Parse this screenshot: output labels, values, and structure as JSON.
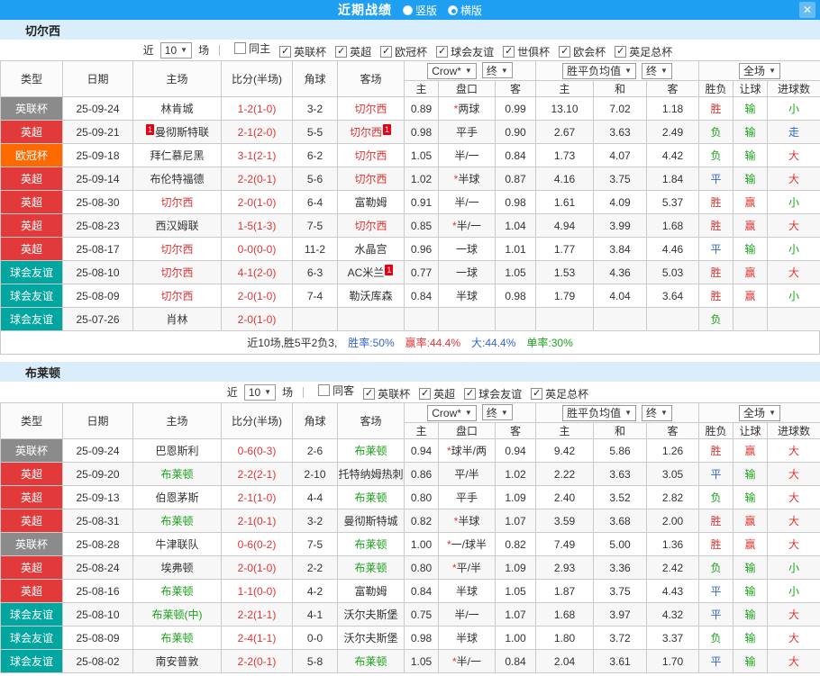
{
  "titlebar": {
    "title": "近期战绩",
    "radios": [
      {
        "label": "竖版",
        "selected": false
      },
      {
        "label": "横版",
        "selected": true
      }
    ],
    "close_label": "✕"
  },
  "filter_labels": {
    "near": "近",
    "count": "10",
    "games": "场"
  },
  "header": {
    "type": "类型",
    "date": "日期",
    "home": "主场",
    "score": "比分(半场)",
    "corner": "角球",
    "away": "客场",
    "odds_company": "Crow*",
    "final1": "终",
    "avg_label": "胜平负均值",
    "final2": "终",
    "scope": "全场",
    "sub": [
      "主",
      "盘口",
      "客",
      "主",
      "和",
      "客",
      "胜负",
      "让球",
      "进球数"
    ]
  },
  "ui_colors": {
    "titlebar_bg": "#1E9FF2",
    "section_band_bg": "#D9EDFB",
    "score_red": "#E23434",
    "win_red": "#E23434",
    "draw_blue": "#3566CD",
    "lose_green": "#1CA21C"
  },
  "type_colors": {
    "英联杯": "#8B8B8B",
    "英超": "#E23A3A",
    "欧冠杯": "#FF6A00",
    "球会友谊": "#01A6A0"
  },
  "result_colors": {
    "胜": "#E23434",
    "赢": "#E23434",
    "大": "#E23434",
    "平": "#3566CD",
    "走": "#3566CD",
    "负": "#1CA21C",
    "输": "#1CA21C",
    "小": "#1CA21C"
  },
  "sections": [
    {
      "team": "切尔西",
      "focus_color": "#E23434",
      "same_label": "同主",
      "same_checked": false,
      "leagues": [
        "英联杯",
        "英超",
        "欧冠杯",
        "球会友谊",
        "世俱杯",
        "欧会杯",
        "英足总杯"
      ],
      "rows": [
        {
          "type": "英联杯",
          "date": "25-09-24",
          "home": {
            "name": "林肯城"
          },
          "score": "1-2(1-0)",
          "corner": "3-2",
          "away": {
            "name": "切尔西",
            "focus": true
          },
          "odds": [
            "0.89",
            "*两球",
            "0.99"
          ],
          "avg": [
            "13.10",
            "7.02",
            "1.18"
          ],
          "result": "胜",
          "handicap_result": "输",
          "goals": "小"
        },
        {
          "type": "英超",
          "date": "25-09-21",
          "home": {
            "name": "曼彻斯特联",
            "badge": "1",
            "badge_pos": "before"
          },
          "score": "2-1(2-0)",
          "corner": "5-5",
          "away": {
            "name": "切尔西",
            "focus": true,
            "badge": "1",
            "badge_pos": "after"
          },
          "odds": [
            "0.98",
            "平手",
            "0.90"
          ],
          "avg": [
            "2.67",
            "3.63",
            "2.49"
          ],
          "result": "负",
          "handicap_result": "输",
          "goals": "走"
        },
        {
          "type": "欧冠杯",
          "date": "25-09-18",
          "home": {
            "name": "拜仁慕尼黑"
          },
          "score": "3-1(2-1)",
          "corner": "6-2",
          "away": {
            "name": "切尔西",
            "focus": true
          },
          "odds": [
            "1.05",
            "半/一",
            "0.84"
          ],
          "avg": [
            "1.73",
            "4.07",
            "4.42"
          ],
          "result": "负",
          "handicap_result": "输",
          "goals": "大"
        },
        {
          "type": "英超",
          "date": "25-09-14",
          "home": {
            "name": "布伦特福德"
          },
          "score": "2-2(0-1)",
          "corner": "5-6",
          "away": {
            "name": "切尔西",
            "focus": true
          },
          "odds": [
            "1.02",
            "*半球",
            "0.87"
          ],
          "avg": [
            "4.16",
            "3.75",
            "1.84"
          ],
          "result": "平",
          "handicap_result": "输",
          "goals": "大"
        },
        {
          "type": "英超",
          "date": "25-08-30",
          "home": {
            "name": "切尔西",
            "focus": true
          },
          "score": "2-0(1-0)",
          "corner": "6-4",
          "away": {
            "name": "富勒姆"
          },
          "odds": [
            "0.91",
            "半/一",
            "0.98"
          ],
          "avg": [
            "1.61",
            "4.09",
            "5.37"
          ],
          "result": "胜",
          "handicap_result": "赢",
          "goals": "小"
        },
        {
          "type": "英超",
          "date": "25-08-23",
          "home": {
            "name": "西汉姆联"
          },
          "score": "1-5(1-3)",
          "corner": "7-5",
          "away": {
            "name": "切尔西",
            "focus": true
          },
          "odds": [
            "0.85",
            "*半/一",
            "1.04"
          ],
          "avg": [
            "4.94",
            "3.99",
            "1.68"
          ],
          "result": "胜",
          "handicap_result": "赢",
          "goals": "大"
        },
        {
          "type": "英超",
          "date": "25-08-17",
          "home": {
            "name": "切尔西",
            "focus": true
          },
          "score": "0-0(0-0)",
          "corner": "11-2",
          "away": {
            "name": "水晶宫"
          },
          "odds": [
            "0.96",
            "一球",
            "1.01"
          ],
          "avg": [
            "1.77",
            "3.84",
            "4.46"
          ],
          "result": "平",
          "handicap_result": "输",
          "goals": "小"
        },
        {
          "type": "球会友谊",
          "date": "25-08-10",
          "home": {
            "name": "切尔西",
            "focus": true
          },
          "score": "4-1(2-0)",
          "corner": "6-3",
          "away": {
            "name": "AC米兰",
            "badge": "1",
            "badge_pos": "after"
          },
          "odds": [
            "0.77",
            "一球",
            "1.05"
          ],
          "avg": [
            "1.53",
            "4.36",
            "5.03"
          ],
          "result": "胜",
          "handicap_result": "赢",
          "goals": "大"
        },
        {
          "type": "球会友谊",
          "date": "25-08-09",
          "home": {
            "name": "切尔西",
            "focus": true
          },
          "score": "2-0(1-0)",
          "corner": "7-4",
          "away": {
            "name": "勒沃库森"
          },
          "odds": [
            "0.84",
            "半球",
            "0.98"
          ],
          "avg": [
            "1.79",
            "4.04",
            "3.64"
          ],
          "result": "胜",
          "handicap_result": "赢",
          "goals": "小"
        },
        {
          "type": "球会友谊",
          "date": "25-07-26",
          "home": {
            "name": "肖林"
          },
          "score": "2-0(1-0)",
          "corner": "",
          "away": {
            "name": ""
          },
          "odds": [
            "",
            "",
            ""
          ],
          "avg": [
            "",
            "",
            ""
          ],
          "result": "负",
          "handicap_result": "",
          "goals": ""
        }
      ],
      "summary": [
        {
          "text": "近10场,胜5平2负3,",
          "color": "#333333"
        },
        {
          "text": "胜率:50%",
          "color": "#3566CD"
        },
        {
          "text": "赢率:44.4%",
          "color": "#E23434"
        },
        {
          "text": "大:44.4%",
          "color": "#3566CD"
        },
        {
          "text": "单率:30%",
          "color": "#1CA21C"
        }
      ]
    },
    {
      "team": "布莱顿",
      "focus_color": "#1CA21C",
      "same_label": "同客",
      "same_checked": false,
      "leagues": [
        "英联杯",
        "英超",
        "球会友谊",
        "英足总杯"
      ],
      "rows": [
        {
          "type": "英联杯",
          "date": "25-09-24",
          "home": {
            "name": "巴恩斯利"
          },
          "score": "0-6(0-3)",
          "corner": "2-6",
          "away": {
            "name": "布莱顿",
            "focus": true
          },
          "odds": [
            "0.94",
            "*球半/两",
            "0.94"
          ],
          "avg": [
            "9.42",
            "5.86",
            "1.26"
          ],
          "result": "胜",
          "handicap_result": "赢",
          "goals": "大"
        },
        {
          "type": "英超",
          "date": "25-09-20",
          "home": {
            "name": "布莱顿",
            "focus": true
          },
          "score": "2-2(2-1)",
          "corner": "2-10",
          "away": {
            "name": "托特纳姆热刺"
          },
          "odds": [
            "0.86",
            "平/半",
            "1.02"
          ],
          "avg": [
            "2.22",
            "3.63",
            "3.05"
          ],
          "result": "平",
          "handicap_result": "输",
          "goals": "大"
        },
        {
          "type": "英超",
          "date": "25-09-13",
          "home": {
            "name": "伯恩茅斯"
          },
          "score": "2-1(1-0)",
          "corner": "4-4",
          "away": {
            "name": "布莱顿",
            "focus": true
          },
          "odds": [
            "0.80",
            "平手",
            "1.09"
          ],
          "avg": [
            "2.40",
            "3.52",
            "2.82"
          ],
          "result": "负",
          "handicap_result": "输",
          "goals": "大"
        },
        {
          "type": "英超",
          "date": "25-08-31",
          "home": {
            "name": "布莱顿",
            "focus": true
          },
          "score": "2-1(0-1)",
          "corner": "3-2",
          "away": {
            "name": "曼彻斯特城"
          },
          "odds": [
            "0.82",
            "*半球",
            "1.07"
          ],
          "avg": [
            "3.59",
            "3.68",
            "2.00"
          ],
          "result": "胜",
          "handicap_result": "赢",
          "goals": "大"
        },
        {
          "type": "英联杯",
          "date": "25-08-28",
          "home": {
            "name": "牛津联队"
          },
          "score": "0-6(0-2)",
          "corner": "7-5",
          "away": {
            "name": "布莱顿",
            "focus": true
          },
          "odds": [
            "1.00",
            "*一/球半",
            "0.82"
          ],
          "avg": [
            "7.49",
            "5.00",
            "1.36"
          ],
          "result": "胜",
          "handicap_result": "赢",
          "goals": "大"
        },
        {
          "type": "英超",
          "date": "25-08-24",
          "home": {
            "name": "埃弗顿"
          },
          "score": "2-0(1-0)",
          "corner": "2-2",
          "away": {
            "name": "布莱顿",
            "focus": true
          },
          "odds": [
            "0.80",
            "*平/半",
            "1.09"
          ],
          "avg": [
            "2.93",
            "3.36",
            "2.42"
          ],
          "result": "负",
          "handicap_result": "输",
          "goals": "小"
        },
        {
          "type": "英超",
          "date": "25-08-16",
          "home": {
            "name": "布莱顿",
            "focus": true
          },
          "score": "1-1(0-0)",
          "corner": "4-2",
          "away": {
            "name": "富勒姆"
          },
          "odds": [
            "0.84",
            "半球",
            "1.05"
          ],
          "avg": [
            "1.87",
            "3.75",
            "4.43"
          ],
          "result": "平",
          "handicap_result": "输",
          "goals": "小"
        },
        {
          "type": "球会友谊",
          "date": "25-08-10",
          "home": {
            "name": "布莱顿(中)",
            "focus": true
          },
          "score": "2-2(1-1)",
          "corner": "4-1",
          "away": {
            "name": "沃尔夫斯堡"
          },
          "odds": [
            "0.75",
            "半/一",
            "1.07"
          ],
          "avg": [
            "1.68",
            "3.97",
            "4.32"
          ],
          "result": "平",
          "handicap_result": "输",
          "goals": "大"
        },
        {
          "type": "球会友谊",
          "date": "25-08-09",
          "home": {
            "name": "布莱顿",
            "focus": true
          },
          "score": "2-4(1-1)",
          "corner": "0-0",
          "away": {
            "name": "沃尔夫斯堡"
          },
          "odds": [
            "0.98",
            "半球",
            "1.00"
          ],
          "avg": [
            "1.80",
            "3.72",
            "3.37"
          ],
          "result": "负",
          "handicap_result": "输",
          "goals": "大"
        },
        {
          "type": "球会友谊",
          "date": "25-08-02",
          "home": {
            "name": "南安普敦"
          },
          "score": "2-2(0-1)",
          "corner": "5-8",
          "away": {
            "name": "布莱顿",
            "focus": true
          },
          "odds": [
            "1.05",
            "*半/一",
            "0.84"
          ],
          "avg": [
            "2.04",
            "3.61",
            "1.70"
          ],
          "result": "平",
          "handicap_result": "输",
          "goals": "大"
        }
      ]
    }
  ]
}
